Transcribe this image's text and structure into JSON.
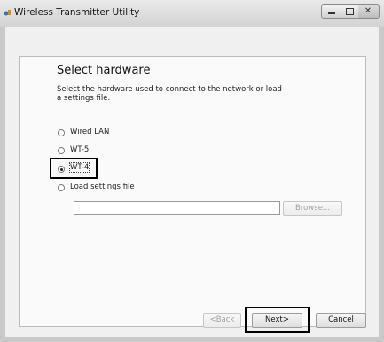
{
  "window": {
    "title": "Wireless Transmitter Utility"
  },
  "wizard": {
    "heading": "Select hardware",
    "description": "Select the hardware used to connect to the network or load a settings file.",
    "options": [
      {
        "label": "Wired LAN",
        "selected": false
      },
      {
        "label": "WT-5",
        "selected": false
      },
      {
        "label": "WT-4",
        "selected": true
      },
      {
        "label": "Load settings file",
        "selected": false
      }
    ],
    "settings_path_value": "",
    "browse_label": "Browse...",
    "back_label": "<Back",
    "next_label": "Next>",
    "cancel_label": "Cancel"
  },
  "icons": {
    "app": "app-icon",
    "minimize": "minimize-icon",
    "maximize": "maximize-icon",
    "close": "close-icon"
  }
}
